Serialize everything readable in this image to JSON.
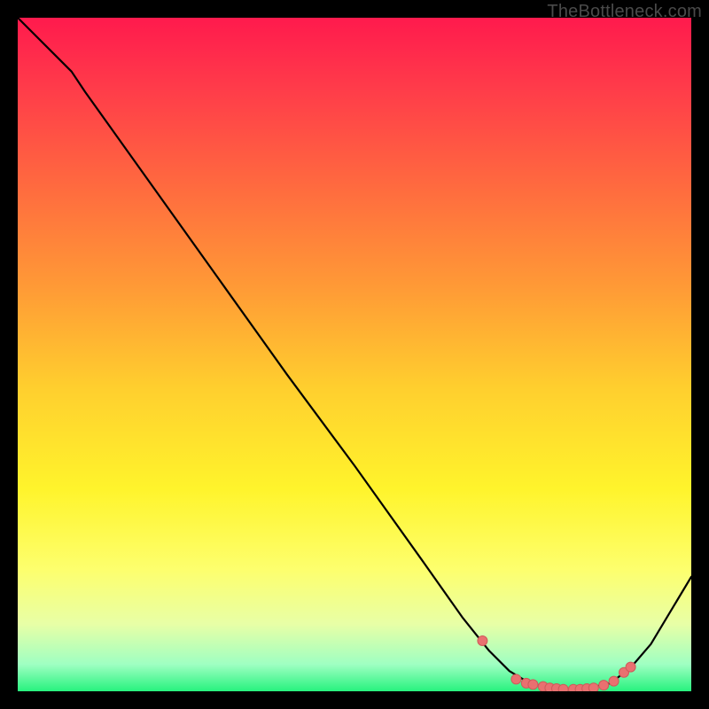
{
  "watermark": "TheBottleneck.com",
  "colors": {
    "curve": "#000000",
    "marker_fill": "#e97070",
    "marker_stroke": "#cf5a5a",
    "gradient_top": "#ff1a4d",
    "gradient_bottom": "#27f27e"
  },
  "chart_data": {
    "type": "line",
    "title": "",
    "xlabel": "",
    "ylabel": "",
    "xlim": [
      0,
      100
    ],
    "ylim": [
      0,
      100
    ],
    "axes_visible": false,
    "curve": [
      {
        "x": 0,
        "y": 100
      },
      {
        "x": 8,
        "y": 92
      },
      {
        "x": 10,
        "y": 89
      },
      {
        "x": 20,
        "y": 75
      },
      {
        "x": 30,
        "y": 61
      },
      {
        "x": 40,
        "y": 47
      },
      {
        "x": 50,
        "y": 33.5
      },
      {
        "x": 60,
        "y": 19.5
      },
      {
        "x": 66,
        "y": 11
      },
      {
        "x": 70,
        "y": 6
      },
      {
        "x": 73,
        "y": 3
      },
      {
        "x": 76,
        "y": 1.2
      },
      {
        "x": 80,
        "y": 0.3
      },
      {
        "x": 84,
        "y": 0.3
      },
      {
        "x": 88,
        "y": 1.2
      },
      {
        "x": 91,
        "y": 3.5
      },
      {
        "x": 94,
        "y": 7
      },
      {
        "x": 100,
        "y": 17
      }
    ],
    "markers": [
      {
        "x": 69,
        "y": 7.5
      },
      {
        "x": 74,
        "y": 1.8
      },
      {
        "x": 75.5,
        "y": 1.2
      },
      {
        "x": 76.5,
        "y": 1.0
      },
      {
        "x": 78,
        "y": 0.7
      },
      {
        "x": 79,
        "y": 0.5
      },
      {
        "x": 80,
        "y": 0.4
      },
      {
        "x": 81,
        "y": 0.3
      },
      {
        "x": 82.5,
        "y": 0.3
      },
      {
        "x": 83.5,
        "y": 0.3
      },
      {
        "x": 84.5,
        "y": 0.4
      },
      {
        "x": 85.5,
        "y": 0.5
      },
      {
        "x": 87,
        "y": 0.9
      },
      {
        "x": 88.5,
        "y": 1.5
      },
      {
        "x": 90,
        "y": 2.8
      },
      {
        "x": 91,
        "y": 3.6
      }
    ]
  }
}
